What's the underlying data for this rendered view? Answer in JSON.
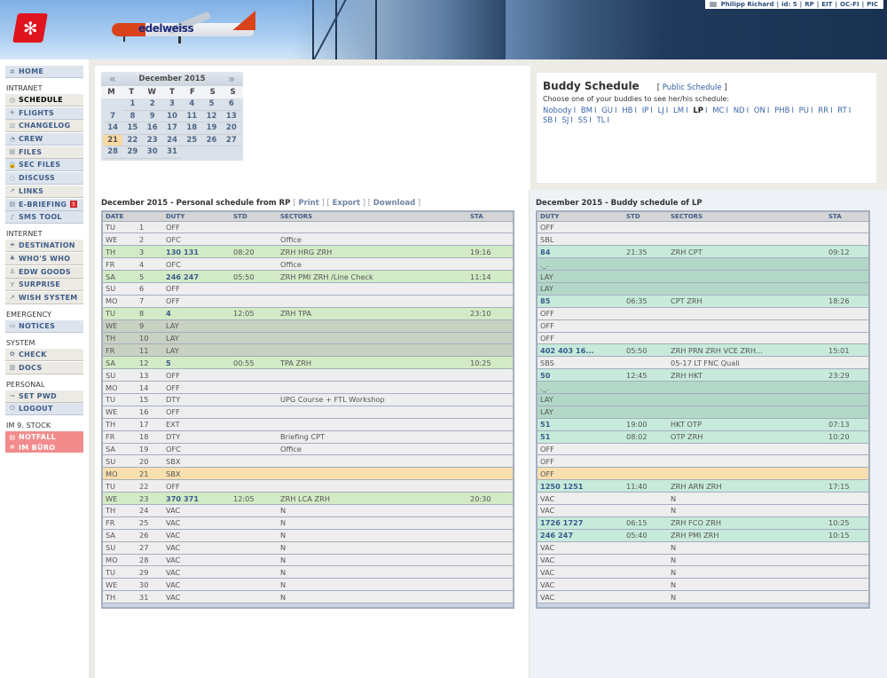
{
  "header": {
    "logo_icon": "edelweiss-flower-icon",
    "aircraft_livery_text": "edelweiss",
    "userbar": {
      "icon": "folder-icon",
      "items": [
        "Philipp Richard",
        "id: 5",
        "RP",
        "EIT",
        "OC-FI",
        "PIC"
      ]
    }
  },
  "sidebar": {
    "home": {
      "label": "HOME",
      "icon": "home-icon"
    },
    "sections": [
      {
        "title": "INTRANET",
        "items": [
          {
            "label": "SCHEDULE",
            "icon": "clock-icon",
            "active": true
          },
          {
            "label": "FLIGHTS",
            "icon": "plane-icon"
          },
          {
            "label": "CHANGELOG",
            "icon": "checklist-icon"
          },
          {
            "label": "CREW",
            "icon": "crew-icon"
          },
          {
            "label": "FILES",
            "icon": "file-icon"
          },
          {
            "label": "SEC FILES",
            "icon": "lock-icon"
          },
          {
            "label": "DISCUSS",
            "icon": "chat-icon"
          },
          {
            "label": "LINKS",
            "icon": "external-link-icon"
          },
          {
            "label": "E-BRIEFING",
            "icon": "document-icon",
            "alert": "!"
          },
          {
            "label": "SMS TOOL",
            "icon": "phone-icon"
          }
        ]
      },
      {
        "title": "INTERNET",
        "items": [
          {
            "label": "DESTINATION",
            "icon": "island-icon"
          },
          {
            "label": "WHO'S WHO",
            "icon": "people-icon"
          },
          {
            "label": "EDW GOODS",
            "icon": "person-icon"
          },
          {
            "label": "SURPRISE",
            "icon": "cocktail-icon"
          },
          {
            "label": "WISH SYSTEM",
            "icon": "external-link-icon"
          }
        ]
      },
      {
        "title": "EMERGENCY",
        "items": [
          {
            "label": "NOTICES",
            "icon": "window-icon"
          }
        ]
      },
      {
        "title": "SYSTEM",
        "items": [
          {
            "label": "CHECK",
            "icon": "gear-icon"
          },
          {
            "label": "DOCS",
            "icon": "book-icon"
          }
        ]
      },
      {
        "title": "PERSONAL",
        "items": [
          {
            "label": "SET PWD",
            "icon": "key-icon"
          },
          {
            "label": "LOGOUT",
            "icon": "power-icon"
          }
        ]
      },
      {
        "title": "IM 9. STOCK",
        "items": [
          {
            "label": "NOTFALL",
            "icon": "document-icon"
          },
          {
            "label": "IM BÜRO",
            "icon": "sun-icon"
          }
        ]
      }
    ]
  },
  "calendar": {
    "title": "December 2015",
    "prev_icon": "double-chevron-left-icon",
    "next_icon": "double-chevron-right-icon",
    "weekdays": [
      "M",
      "T",
      "W",
      "T",
      "F",
      "S",
      "S"
    ],
    "first_weekday_offset": 1,
    "days_in_month": 31,
    "today": 21
  },
  "buddy": {
    "title": "Buddy Schedule",
    "public_link": "Public Schedule",
    "description": "Choose one of your buddies to see her/his schedule:",
    "buddies": [
      "Nobody",
      "BM",
      "GU",
      "HB",
      "IP",
      "LJ",
      "LM",
      "LP",
      "MC",
      "ND",
      "ON",
      "PHB",
      "PU",
      "RR",
      "RT",
      "SB",
      "SJ",
      "SS",
      "TL"
    ],
    "selected": "LP"
  },
  "personal_schedule": {
    "title": "December 2015 - Personal schedule from RP",
    "links": [
      "Print",
      "Export",
      "Download"
    ],
    "columns": [
      "DATE",
      "",
      "DUTY",
      "STD",
      "SECTORS",
      "STA"
    ],
    "rows": [
      {
        "dow": "TU",
        "day": "1",
        "duty": "OFF",
        "std": "",
        "sectors": "",
        "sta": "",
        "type": ""
      },
      {
        "dow": "WE",
        "day": "2",
        "duty": "OFC",
        "std": "",
        "sectors": "Office",
        "sta": "",
        "type": ""
      },
      {
        "dow": "TH",
        "day": "3",
        "duty": "130 131",
        "std": "08:20",
        "sectors": "ZRH HRG ZRH",
        "sta": "19:16",
        "type": "flight"
      },
      {
        "dow": "FR",
        "day": "4",
        "duty": "OFC",
        "std": "",
        "sectors": "Office",
        "sta": "",
        "type": ""
      },
      {
        "dow": "SA",
        "day": "5",
        "duty": "246 247",
        "std": "05:50",
        "sectors": "ZRH PMI ZRH /Line Check",
        "sta": "11:14",
        "type": "flight"
      },
      {
        "dow": "SU",
        "day": "6",
        "duty": "OFF",
        "std": "",
        "sectors": "",
        "sta": "",
        "type": ""
      },
      {
        "dow": "MO",
        "day": "7",
        "duty": "OFF",
        "std": "",
        "sectors": "",
        "sta": "",
        "type": ""
      },
      {
        "dow": "TU",
        "day": "8",
        "duty": "4",
        "std": "12:05",
        "sectors": "ZRH TPA",
        "sta": "23:10",
        "type": "flight"
      },
      {
        "dow": "WE",
        "day": "9",
        "duty": "LAY",
        "std": "",
        "sectors": "",
        "sta": "",
        "type": "lay"
      },
      {
        "dow": "TH",
        "day": "10",
        "duty": "LAY",
        "std": "",
        "sectors": "",
        "sta": "",
        "type": "lay"
      },
      {
        "dow": "FR",
        "day": "11",
        "duty": "LAY",
        "std": "",
        "sectors": "",
        "sta": "",
        "type": "lay"
      },
      {
        "dow": "SA",
        "day": "12",
        "duty": "5",
        "std": "00:55",
        "sectors": "TPA ZRH",
        "sta": "10:25",
        "type": "flight"
      },
      {
        "dow": "SU",
        "day": "13",
        "duty": "OFF",
        "std": "",
        "sectors": "",
        "sta": "",
        "type": ""
      },
      {
        "dow": "MO",
        "day": "14",
        "duty": "OFF",
        "std": "",
        "sectors": "",
        "sta": "",
        "type": ""
      },
      {
        "dow": "TU",
        "day": "15",
        "duty": "DTY",
        "std": "",
        "sectors": "UPG Course + FTL Workshop",
        "sta": "",
        "type": ""
      },
      {
        "dow": "WE",
        "day": "16",
        "duty": "OFF",
        "std": "",
        "sectors": "",
        "sta": "",
        "type": ""
      },
      {
        "dow": "TH",
        "day": "17",
        "duty": "EXT",
        "std": "",
        "sectors": "",
        "sta": "",
        "type": ""
      },
      {
        "dow": "FR",
        "day": "18",
        "duty": "DTY",
        "std": "",
        "sectors": "Briefing CPT",
        "sta": "",
        "type": ""
      },
      {
        "dow": "SA",
        "day": "19",
        "duty": "OFC",
        "std": "",
        "sectors": "Office",
        "sta": "",
        "type": ""
      },
      {
        "dow": "SU",
        "day": "20",
        "duty": "SBX",
        "std": "",
        "sectors": "",
        "sta": "",
        "type": ""
      },
      {
        "dow": "MO",
        "day": "21",
        "duty": "SBX",
        "std": "",
        "sectors": "",
        "sta": "",
        "type": "today"
      },
      {
        "dow": "TU",
        "day": "22",
        "duty": "OFF",
        "std": "",
        "sectors": "",
        "sta": "",
        "type": ""
      },
      {
        "dow": "WE",
        "day": "23",
        "duty": "370 371",
        "std": "12:05",
        "sectors": "ZRH LCA ZRH",
        "sta": "20:30",
        "type": "flight"
      },
      {
        "dow": "TH",
        "day": "24",
        "duty": "VAC",
        "std": "",
        "sectors": "N",
        "sta": "",
        "type": ""
      },
      {
        "dow": "FR",
        "day": "25",
        "duty": "VAC",
        "std": "",
        "sectors": "N",
        "sta": "",
        "type": ""
      },
      {
        "dow": "SA",
        "day": "26",
        "duty": "VAC",
        "std": "",
        "sectors": "N",
        "sta": "",
        "type": ""
      },
      {
        "dow": "SU",
        "day": "27",
        "duty": "VAC",
        "std": "",
        "sectors": "N",
        "sta": "",
        "type": ""
      },
      {
        "dow": "MO",
        "day": "28",
        "duty": "VAC",
        "std": "",
        "sectors": "N",
        "sta": "",
        "type": ""
      },
      {
        "dow": "TU",
        "day": "29",
        "duty": "VAC",
        "std": "",
        "sectors": "N",
        "sta": "",
        "type": ""
      },
      {
        "dow": "WE",
        "day": "30",
        "duty": "VAC",
        "std": "",
        "sectors": "N",
        "sta": "",
        "type": ""
      },
      {
        "dow": "TH",
        "day": "31",
        "duty": "VAC",
        "std": "",
        "sectors": "N",
        "sta": "",
        "type": ""
      }
    ]
  },
  "buddy_schedule": {
    "title": "December 2015 - Buddy schedule of LP",
    "columns": [
      "DUTY",
      "STD",
      "SECTORS",
      "STA"
    ],
    "rows": [
      {
        "duty": "OFF",
        "std": "",
        "sectors": "",
        "sta": "",
        "type": ""
      },
      {
        "duty": "SBL",
        "std": "",
        "sectors": "",
        "sta": "",
        "type": ""
      },
      {
        "duty": "84",
        "std": "21:35",
        "sectors": "ZRH CPT",
        "sta": "09:12",
        "type": "flight"
      },
      {
        "duty": "._.",
        "std": "",
        "sectors": "",
        "sta": "",
        "type": "lay"
      },
      {
        "duty": "LAY",
        "std": "",
        "sectors": "",
        "sta": "",
        "type": "lay"
      },
      {
        "duty": "LAY",
        "std": "",
        "sectors": "",
        "sta": "",
        "type": "lay"
      },
      {
        "duty": "85",
        "std": "06:35",
        "sectors": "CPT ZRH",
        "sta": "18:26",
        "type": "flight"
      },
      {
        "duty": "OFF",
        "std": "",
        "sectors": "",
        "sta": "",
        "type": ""
      },
      {
        "duty": "OFF",
        "std": "",
        "sectors": "",
        "sta": "",
        "type": ""
      },
      {
        "duty": "OFF",
        "std": "",
        "sectors": "",
        "sta": "",
        "type": ""
      },
      {
        "duty": "402 403 16...",
        "std": "05:50",
        "sectors": "ZRH PRN ZRH VCE ZRH...",
        "sta": "15:01",
        "type": "flight"
      },
      {
        "duty": "SBS",
        "std": "",
        "sectors": "05-17 LT FNC Quali",
        "sta": "",
        "type": ""
      },
      {
        "duty": "50",
        "std": "12:45",
        "sectors": "ZRH HKT",
        "sta": "23:29",
        "type": "flight"
      },
      {
        "duty": "._.",
        "std": "",
        "sectors": "",
        "sta": "",
        "type": "lay"
      },
      {
        "duty": "LAY",
        "std": "",
        "sectors": "",
        "sta": "",
        "type": "lay"
      },
      {
        "duty": "LAY",
        "std": "",
        "sectors": "",
        "sta": "",
        "type": "lay"
      },
      {
        "duty": "51",
        "std": "19:00",
        "sectors": "HKT OTP",
        "sta": "07:13",
        "type": "flight"
      },
      {
        "duty": "51",
        "std": "08:02",
        "sectors": "OTP ZRH",
        "sta": "10:20",
        "type": "flight"
      },
      {
        "duty": "OFF",
        "std": "",
        "sectors": "",
        "sta": "",
        "type": ""
      },
      {
        "duty": "OFF",
        "std": "",
        "sectors": "",
        "sta": "",
        "type": ""
      },
      {
        "duty": "OFF",
        "std": "",
        "sectors": "",
        "sta": "",
        "type": "today"
      },
      {
        "duty": "1250 1251",
        "std": "11:40",
        "sectors": "ZRH ARN ZRH",
        "sta": "17:15",
        "type": "flight"
      },
      {
        "duty": "VAC",
        "std": "",
        "sectors": "N",
        "sta": "",
        "type": ""
      },
      {
        "duty": "VAC",
        "std": "",
        "sectors": "N",
        "sta": "",
        "type": ""
      },
      {
        "duty": "1726 1727",
        "std": "06:15",
        "sectors": "ZRH FCO ZRH",
        "sta": "10:25",
        "type": "flight"
      },
      {
        "duty": "246 247",
        "std": "05:40",
        "sectors": "ZRH PMI ZRH",
        "sta": "10:15",
        "type": "flight"
      },
      {
        "duty": "VAC",
        "std": "",
        "sectors": "N",
        "sta": "",
        "type": ""
      },
      {
        "duty": "VAC",
        "std": "",
        "sectors": "N",
        "sta": "",
        "type": ""
      },
      {
        "duty": "VAC",
        "std": "",
        "sectors": "N",
        "sta": "",
        "type": ""
      },
      {
        "duty": "VAC",
        "std": "",
        "sectors": "N",
        "sta": "",
        "type": ""
      },
      {
        "duty": "VAC",
        "std": "",
        "sectors": "N",
        "sta": "",
        "type": ""
      }
    ]
  }
}
